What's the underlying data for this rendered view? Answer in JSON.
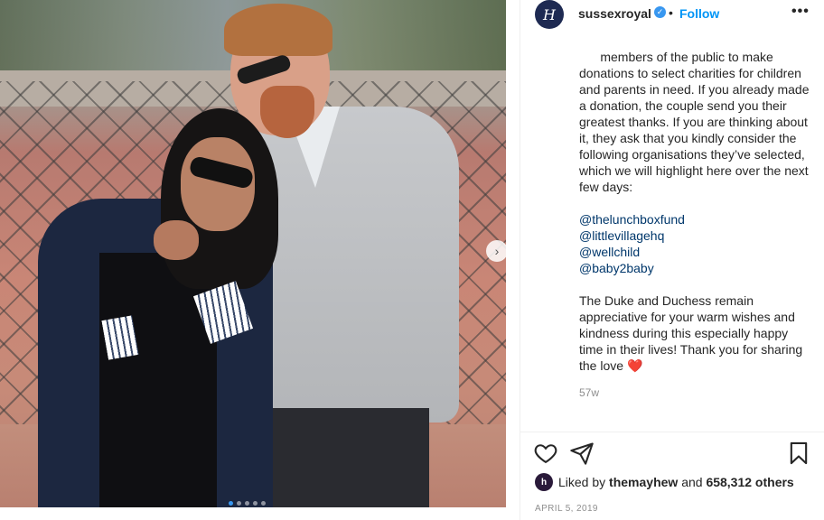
{
  "post": {
    "account": {
      "username": "sussexroyal",
      "verified_mark": "✓",
      "separator": "•",
      "follow_label": "Follow",
      "more_label": "•••",
      "avatar_monogram": "H"
    },
    "caption": {
      "intro": "members of the public to make donations to select charities for children and parents in need. If you already made a donation, the couple send you their greatest thanks. If you are thinking about it, they ask that you kindly consider the following organisations they’ve selected, which we will highlight here over the next few days:",
      "mentions": [
        "@thelunchboxfund",
        "@littlevillagehq",
        "@wellchild",
        "@baby2baby"
      ],
      "outro": "The Duke and Duchess remain appreciative for your warm wishes and kindness during this especially happy time in their lives! Thank you for sharing the love",
      "emoji": "❤️"
    },
    "comment_time": "57w",
    "likes": {
      "prefix": "Liked by",
      "user": "themayhew",
      "connector": "and",
      "count": "658,312 others",
      "avatar_text": "h"
    },
    "date": "APRIL 5, 2019",
    "carousel": {
      "next_label": "›",
      "active_index": 0,
      "total": 5
    },
    "icons": [
      "heart-icon",
      "share-icon",
      "bookmark-icon",
      "chevron-right-icon",
      "verified-icon"
    ]
  }
}
